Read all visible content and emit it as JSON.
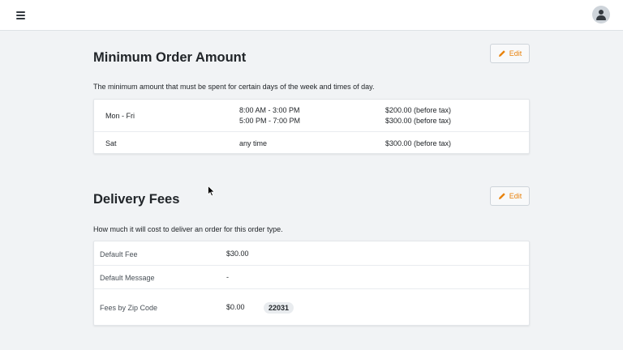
{
  "header": {
    "menu_icon": "hamburger-menu-icon",
    "avatar_icon": "user-avatar-icon"
  },
  "min_order": {
    "title": "Minimum Order Amount",
    "edit_label": "Edit",
    "description": "The minimum amount that must be spent for certain days of the week and times of day.",
    "rows": [
      {
        "days": "Mon - Fri",
        "times": [
          "8:00 AM - 3:00 PM",
          "5:00 PM - 7:00 PM"
        ],
        "amounts": [
          "$200.00 (before tax)",
          "$300.00 (before tax)"
        ]
      },
      {
        "days": "Sat",
        "times": [
          "any time"
        ],
        "amounts": [
          "$300.00 (before tax)"
        ]
      }
    ]
  },
  "delivery": {
    "title": "Delivery Fees",
    "edit_label": "Edit",
    "description": "How much it will cost to deliver an order for this order type.",
    "rows": [
      {
        "label": "Default Fee",
        "value": "$30.00"
      },
      {
        "label": "Default Message",
        "value": "-"
      },
      {
        "label": "Fees by Zip Code",
        "value": "$0.00",
        "zip": "22031"
      }
    ]
  },
  "colors": {
    "accent": "#e8820c",
    "background": "#f1f3f5",
    "card": "#ffffff"
  }
}
